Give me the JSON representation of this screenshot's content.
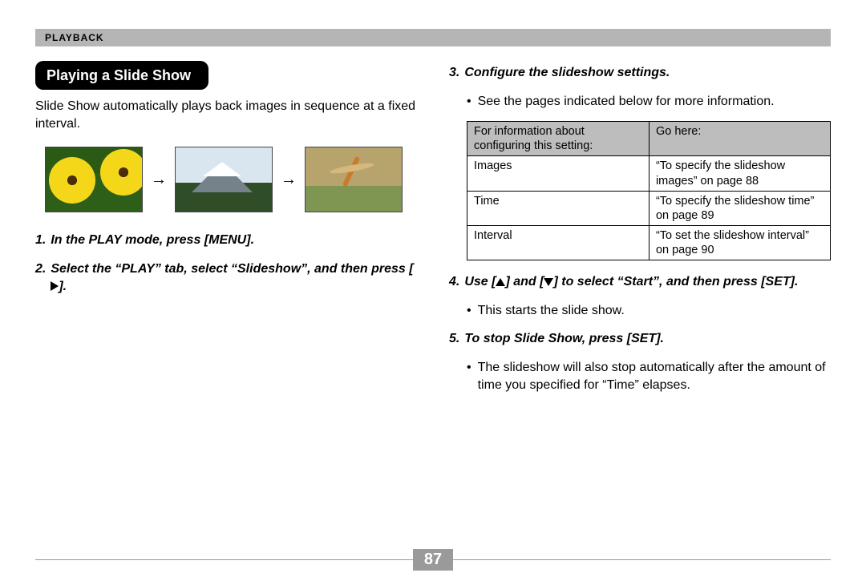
{
  "header": {
    "section_label": "PLAYBACK"
  },
  "left": {
    "section_title": "Playing a Slide Show",
    "intro": "Slide Show automatically plays back images in sequence at a fixed interval.",
    "step1_num": "1.",
    "step1_text": "In the PLAY mode, press [MENU].",
    "step2_num": "2.",
    "step2_text_a": "Select the “PLAY” tab, select “Slideshow”, and then press [",
    "step2_text_b": "]."
  },
  "right": {
    "step3_num": "3.",
    "step3_text": "Configure the slideshow settings.",
    "step3_bullet": "See the pages indicated below for more information.",
    "table": {
      "head_a": "For information about configuring this setting:",
      "head_b": "Go here:",
      "rows": [
        {
          "a": "Images",
          "b": "“To specify the slideshow images” on page 88"
        },
        {
          "a": "Time",
          "b": "“To specify the slideshow time” on page 89"
        },
        {
          "a": "Interval",
          "b": "“To set the slideshow interval” on page 90"
        }
      ]
    },
    "step4_num": "4.",
    "step4_a": "Use [",
    "step4_b": "] and [",
    "step4_c": "] to select “Start”, and then press [SET].",
    "step4_bullet": "This starts the slide show.",
    "step5_num": "5.",
    "step5_text": "To stop Slide Show, press [SET].",
    "step5_bullet": "The slideshow will also stop automatically after the amount of time you specified for “Time” elapses."
  },
  "footer": {
    "page_number": "87"
  }
}
